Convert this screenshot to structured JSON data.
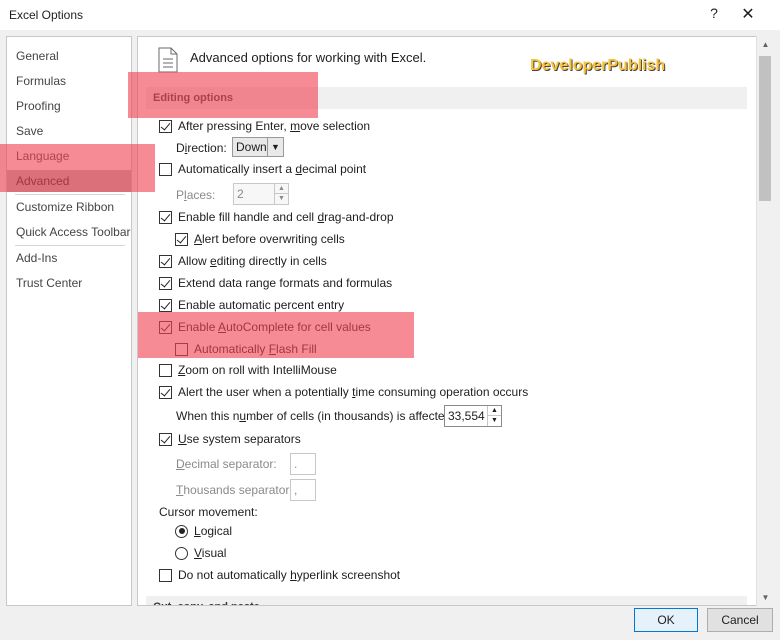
{
  "window": {
    "title": "Excel Options",
    "help_glyph": "?",
    "close_glyph": "✕"
  },
  "nav": {
    "items": [
      {
        "label": "General"
      },
      {
        "label": "Formulas"
      },
      {
        "label": "Proofing"
      },
      {
        "label": "Save"
      },
      {
        "label": "Language"
      },
      {
        "label": "Advanced"
      },
      {
        "label": "Customize Ribbon"
      },
      {
        "label": "Quick Access Toolbar"
      },
      {
        "label": "Add-Ins"
      },
      {
        "label": "Trust Center"
      }
    ],
    "selected": "Advanced"
  },
  "content": {
    "heading": "Advanced options for working with Excel.",
    "watermark": "DeveloperPublish",
    "section_editing": "Editing options",
    "section_next": "Cut, copy, and paste",
    "options": {
      "after_enter": {
        "pre": "After pressing Enter, ",
        "u": "m",
        "post": "ove selection",
        "checked": true
      },
      "direction_label": {
        "pre": "D",
        "u": "i",
        "post": "rection:"
      },
      "direction_value": "Down",
      "auto_decimal": {
        "pre": "Automatically insert a ",
        "u": "d",
        "post": "ecimal point",
        "checked": false
      },
      "places_label": {
        "pre": "P",
        "u": "l",
        "post": "aces:"
      },
      "places_value": "2",
      "fill_handle": {
        "pre": "Enable fill handle and cell ",
        "u": "d",
        "post": "rag-and-drop",
        "checked": true
      },
      "alert_overwrite": {
        "pre": "",
        "u": "A",
        "post": "lert before overwriting cells",
        "checked": true
      },
      "allow_editing": {
        "pre": "Allow ",
        "u": "e",
        "post": "diting directly in cells",
        "checked": true
      },
      "extend_range": {
        "pre": "Extend data range formats and formulas",
        "u": "",
        "post": "",
        "checked": true
      },
      "auto_percent": {
        "pre": "Enable automatic percent entry",
        "u": "",
        "post": "",
        "checked": true
      },
      "autocomplete": {
        "pre": "Enable ",
        "u": "A",
        "post": "utoComplete for cell values",
        "checked": true
      },
      "flash_fill": {
        "pre": "Automatically ",
        "u": "F",
        "post": "lash Fill",
        "checked": false
      },
      "zoom_roll": {
        "pre": "",
        "u": "Z",
        "post": "oom on roll with IntelliMouse",
        "checked": false
      },
      "alert_time": {
        "pre": "Alert the user when a potentially ",
        "u": "t",
        "post": "ime consuming operation occurs",
        "checked": true
      },
      "cells_affected_label": {
        "pre": "When this n",
        "u": "u",
        "post": "mber of cells (in thousands) is affected:"
      },
      "cells_affected_value": "33,554",
      "system_sep": {
        "pre": "",
        "u": "U",
        "post": "se system separators",
        "checked": true
      },
      "decimal_sep_label": {
        "pre": "",
        "u": "D",
        "post": "ecimal separator:"
      },
      "decimal_sep_value": ".",
      "thousands_sep_label": {
        "pre": "",
        "u": "T",
        "post": "housands separator:"
      },
      "thousands_sep_value": ",",
      "cursor_movement_label": "Cursor movement:",
      "logical": {
        "pre": "",
        "u": "L",
        "post": "ogical",
        "checked": true
      },
      "visual": {
        "pre": "",
        "u": "V",
        "post": "isual",
        "checked": false
      },
      "no_hyperlink": {
        "pre": "Do not automatically ",
        "u": "h",
        "post": "yperlink screenshot",
        "checked": false
      }
    }
  },
  "footer": {
    "ok": "OK",
    "cancel": "Cancel"
  },
  "colors": {
    "highlight": "#f24454",
    "selected_nav": "#b7b7b7",
    "watermark": "#f9c23c"
  }
}
